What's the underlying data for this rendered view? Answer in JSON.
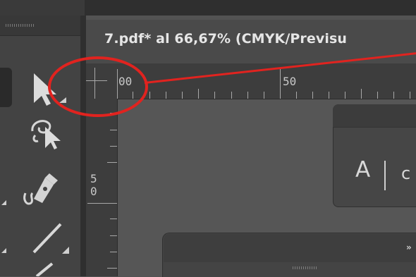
{
  "document": {
    "tab_title": "7.pdf* al 66,67% (CMYK/Previsu"
  },
  "rulers": {
    "top_labels": [
      "00",
      "50"
    ],
    "left_label_lines": [
      "5",
      "0"
    ]
  },
  "tools_panel": {
    "items": [
      {
        "name": "selection-tool",
        "icon": "arrow-pointer-icon"
      },
      {
        "name": "direct-selection-tool",
        "icon": "lasso-arrow-icon"
      },
      {
        "name": "pen-tool",
        "icon": "pen-nib-icon"
      },
      {
        "name": "line-tool",
        "icon": "line-icon"
      },
      {
        "name": "pencil-tool",
        "icon": "pencil-icon"
      }
    ]
  },
  "text_panel": {
    "icon_text": "A",
    "label": "c"
  },
  "lower_panel": {
    "collapse_glyph": "»"
  },
  "annotation": {
    "color": "#e1231f"
  },
  "colors": {
    "background": "#535353",
    "panel": "#434343",
    "ruler": "#3d3d3d",
    "text": "#e6e6e6"
  }
}
